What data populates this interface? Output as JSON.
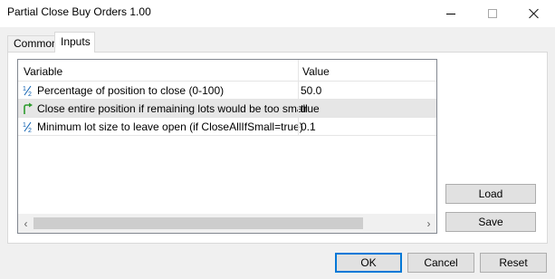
{
  "window": {
    "title": "Partial Close Buy Orders 1.00"
  },
  "tabs": [
    {
      "label": "Common",
      "active": false
    },
    {
      "label": "Inputs",
      "active": true
    }
  ],
  "grid": {
    "columns": [
      "Variable",
      "Value"
    ],
    "rows": [
      {
        "icon": "fraction-half-icon",
        "name": "Percentage of position to close (0-100)",
        "value": "50.0",
        "selected": false
      },
      {
        "icon": "green-arrow-icon",
        "name": "Close entire position if remaining lots would be too small",
        "value": "true",
        "selected": true
      },
      {
        "icon": "fraction-half-icon",
        "name": "Minimum lot size to leave open (if CloseAllIfSmall=true)",
        "value": "0.1",
        "selected": false
      }
    ]
  },
  "buttons": {
    "load": "Load",
    "save": "Save",
    "ok": "OK",
    "cancel": "Cancel",
    "reset": "Reset"
  }
}
